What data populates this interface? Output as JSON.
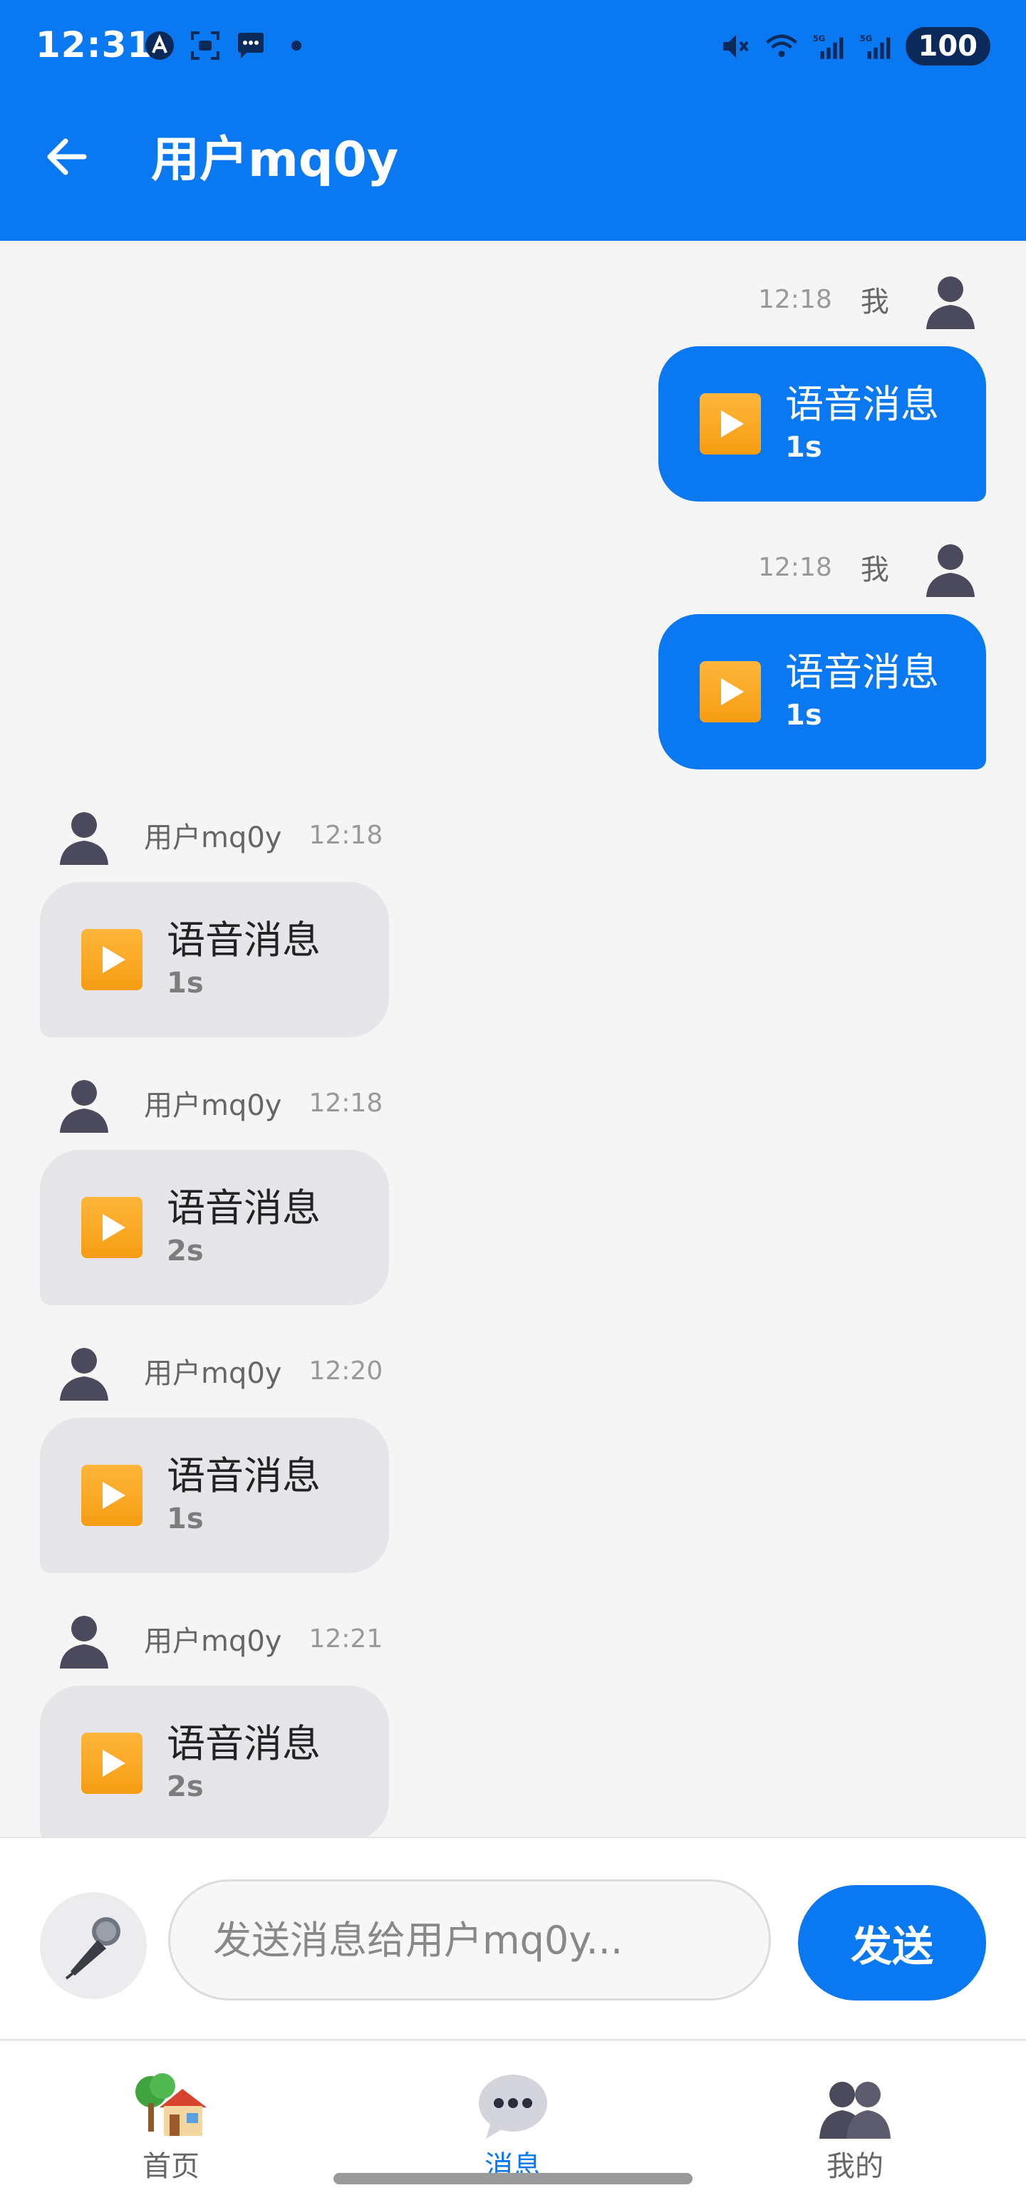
{
  "status_bar": {
    "time": "12:31",
    "battery": "100",
    "network_labels": [
      "5G",
      "5G"
    ]
  },
  "header": {
    "title": "用户mq0y",
    "back_icon": "arrow-left-icon"
  },
  "messages": [
    {
      "side": "mine",
      "name": "我",
      "time": "12:18",
      "label": "语音消息",
      "duration": "1s"
    },
    {
      "side": "mine",
      "name": "我",
      "time": "12:18",
      "label": "语音消息",
      "duration": "1s"
    },
    {
      "side": "theirs",
      "name": "用户mq0y",
      "time": "12:18",
      "label": "语音消息",
      "duration": "1s"
    },
    {
      "side": "theirs",
      "name": "用户mq0y",
      "time": "12:18",
      "label": "语音消息",
      "duration": "2s"
    },
    {
      "side": "theirs",
      "name": "用户mq0y",
      "time": "12:20",
      "label": "语音消息",
      "duration": "1s"
    },
    {
      "side": "theirs",
      "name": "用户mq0y",
      "time": "12:21",
      "label": "语音消息",
      "duration": "2s"
    }
  ],
  "input": {
    "placeholder": "发送消息给用户mq0y...",
    "value": "",
    "send_label": "发送",
    "mic_icon": "microphone-icon"
  },
  "nav": {
    "items": [
      {
        "label": "首页",
        "icon": "house-icon",
        "active": false
      },
      {
        "label": "消息",
        "icon": "chat-bubble-icon",
        "active": true
      },
      {
        "label": "我的",
        "icon": "people-icon",
        "active": false
      }
    ]
  },
  "colors": {
    "primary": "#0a78f0",
    "bubble_theirs": "#e6e6ea",
    "background": "#f5f5f5"
  }
}
